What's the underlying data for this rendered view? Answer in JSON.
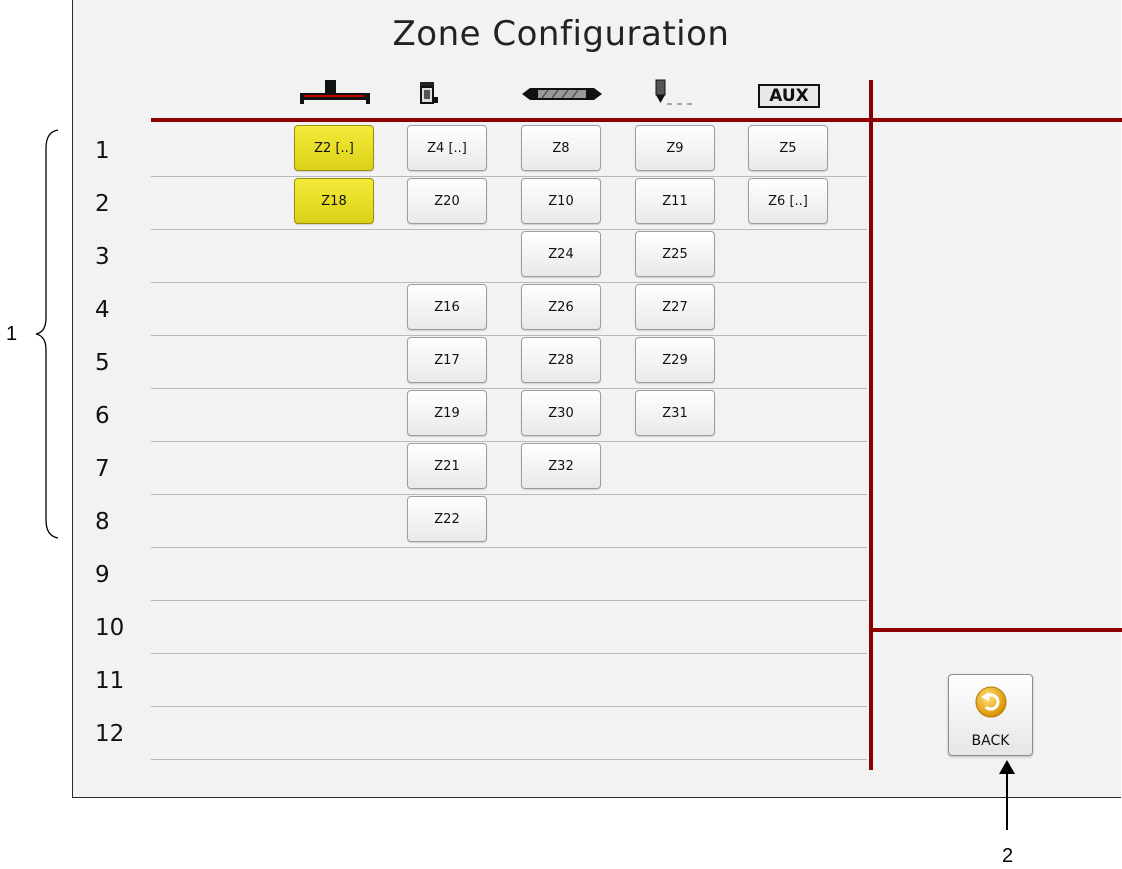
{
  "title": "Zone Configuration",
  "columns": [
    {
      "icon": "extruder-head-icon"
    },
    {
      "icon": "melt-unit-icon"
    },
    {
      "icon": "heated-hose-icon"
    },
    {
      "icon": "nozzle-icon"
    },
    {
      "icon": "aux-icon",
      "label": "AUX"
    }
  ],
  "rows": [
    "1",
    "2",
    "3",
    "4",
    "5",
    "6",
    "7",
    "8",
    "9",
    "10",
    "11",
    "12"
  ],
  "zones": [
    {
      "label": "Z2 [..]",
      "row": 1,
      "col": 1,
      "selected": true
    },
    {
      "label": "Z4 [..]",
      "row": 1,
      "col": 2
    },
    {
      "label": "Z8",
      "row": 1,
      "col": 3
    },
    {
      "label": "Z9",
      "row": 1,
      "col": 4
    },
    {
      "label": "Z5",
      "row": 1,
      "col": 5
    },
    {
      "label": "Z18",
      "row": 2,
      "col": 1,
      "selected": true
    },
    {
      "label": "Z20",
      "row": 2,
      "col": 2
    },
    {
      "label": "Z10",
      "row": 2,
      "col": 3
    },
    {
      "label": "Z11",
      "row": 2,
      "col": 4
    },
    {
      "label": "Z6 [..]",
      "row": 2,
      "col": 5
    },
    {
      "label": "Z24",
      "row": 3,
      "col": 3
    },
    {
      "label": "Z25",
      "row": 3,
      "col": 4
    },
    {
      "label": "Z16",
      "row": 4,
      "col": 2
    },
    {
      "label": "Z26",
      "row": 4,
      "col": 3
    },
    {
      "label": "Z27",
      "row": 4,
      "col": 4
    },
    {
      "label": "Z17",
      "row": 5,
      "col": 2
    },
    {
      "label": "Z28",
      "row": 5,
      "col": 3
    },
    {
      "label": "Z29",
      "row": 5,
      "col": 4
    },
    {
      "label": "Z19",
      "row": 6,
      "col": 2
    },
    {
      "label": "Z30",
      "row": 6,
      "col": 3
    },
    {
      "label": "Z31",
      "row": 6,
      "col": 4
    },
    {
      "label": "Z21",
      "row": 7,
      "col": 2
    },
    {
      "label": "Z32",
      "row": 7,
      "col": 3
    },
    {
      "label": "Z22",
      "row": 8,
      "col": 2
    }
  ],
  "back": {
    "label": "BACK",
    "icon": "back-arrow-icon"
  },
  "callouts": {
    "rows_label": "1",
    "back_label": "2"
  },
  "colors": {
    "accent": "#8b0000",
    "selected": "#e8dc20"
  }
}
